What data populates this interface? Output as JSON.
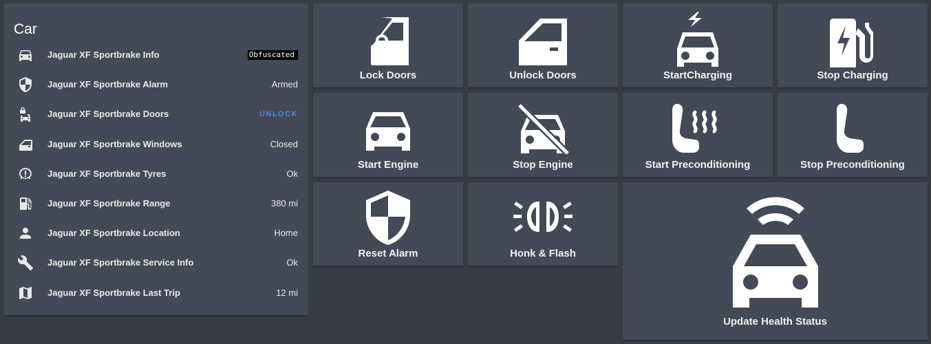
{
  "car_card": {
    "title": "Car",
    "rows": [
      {
        "icon": "car-icon",
        "name": "Jaguar XF Sportbrake Info",
        "state": "Obfuscated"
      },
      {
        "icon": "shield-icon",
        "name": "Jaguar XF Sportbrake Alarm",
        "state": "Armed"
      },
      {
        "icon": "car-door-lock-icon",
        "name": "Jaguar XF Sportbrake Doors",
        "state": "UNLOCK"
      },
      {
        "icon": "car-door-icon",
        "name": "Jaguar XF Sportbrake Windows",
        "state": "Closed"
      },
      {
        "icon": "tire-alert-icon",
        "name": "Jaguar XF Sportbrake Tyres",
        "state": "Ok"
      },
      {
        "icon": "gas-station-icon",
        "name": "Jaguar XF Sportbrake Range",
        "state": "380 mi"
      },
      {
        "icon": "person-icon",
        "name": "Jaguar XF Sportbrake Location",
        "state": "Home"
      },
      {
        "icon": "wrench-icon",
        "name": "Jaguar XF Sportbrake Service Info",
        "state": "Ok"
      },
      {
        "icon": "map-icon",
        "name": "Jaguar XF Sportbrake Last Trip",
        "state": "12 mi"
      }
    ]
  },
  "buttons": {
    "lock_doors": {
      "label": "Lock Doors",
      "icon": "car-door-lock-icon"
    },
    "unlock_doors": {
      "label": "Unlock Doors",
      "icon": "car-door-icon"
    },
    "start_charging": {
      "label": "StartCharging",
      "icon": "car-electric-icon"
    },
    "stop_charging": {
      "label": "Stop Charging",
      "icon": "ev-station-icon"
    },
    "start_engine": {
      "label": "Start Engine",
      "icon": "car-icon"
    },
    "stop_engine": {
      "label": "Stop Engine",
      "icon": "car-off-icon"
    },
    "start_preconditioning": {
      "label": "Start Preconditioning",
      "icon": "seat-heater-icon"
    },
    "stop_preconditioning": {
      "label": "Stop Preconditioning",
      "icon": "seat-icon"
    },
    "reset_alarm": {
      "label": "Reset Alarm",
      "icon": "shield-half-full-icon"
    },
    "honk_flash": {
      "label": "Honk & Flash",
      "icon": "car-light-high-icon"
    },
    "update_health": {
      "label": "Update Health Status",
      "icon": "car-connected-icon"
    }
  },
  "colors": {
    "background": "#383c45",
    "card": "#434956",
    "action_link": "#4f87d8"
  }
}
